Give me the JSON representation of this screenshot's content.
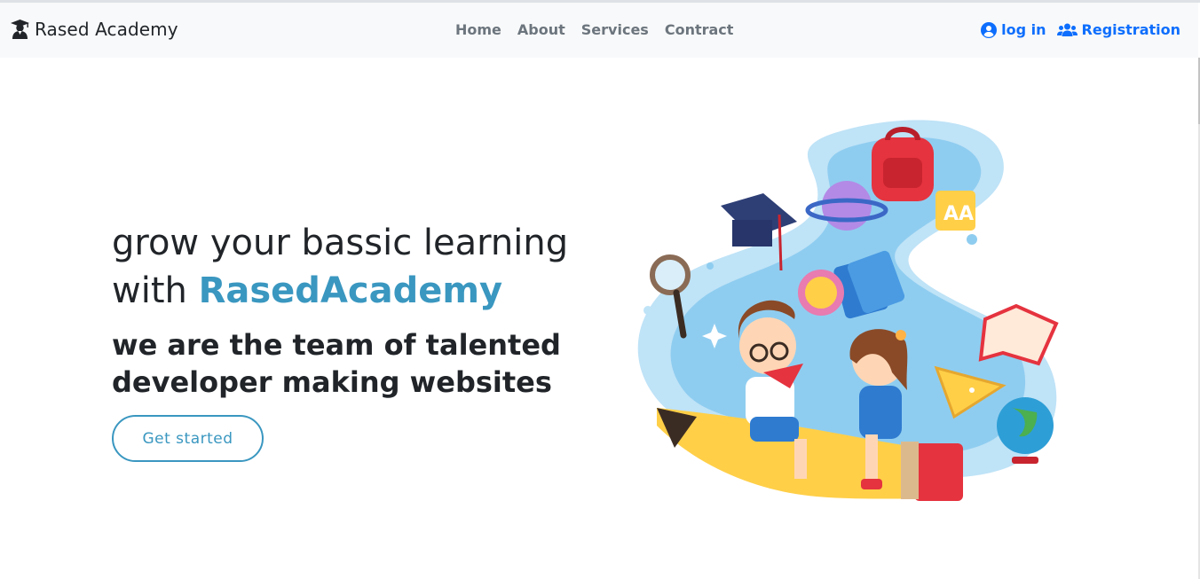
{
  "brand": {
    "name": "Rased Academy",
    "icon": "graduate-icon"
  },
  "nav": {
    "links": [
      "Home",
      "About",
      "Services",
      "Contract"
    ]
  },
  "auth": {
    "login_label": "log in",
    "login_icon": "user-circle-icon",
    "register_label": "Registration",
    "register_icon": "users-icon"
  },
  "hero": {
    "title_line1": "grow your bassic learning",
    "title_line2_prefix": "with ",
    "title_accent": "RasedAcademy",
    "subtitle_line1": "we are the team of talented",
    "subtitle_line2": "developer making websites",
    "cta_label": "Get started",
    "illustration": "kids-riding-pencil-illustration"
  },
  "colors": {
    "accent": "#3a97c0",
    "link_blue": "#0d6efd",
    "nav_gray": "#6c757d",
    "navbar_bg": "#f8f9fa"
  }
}
